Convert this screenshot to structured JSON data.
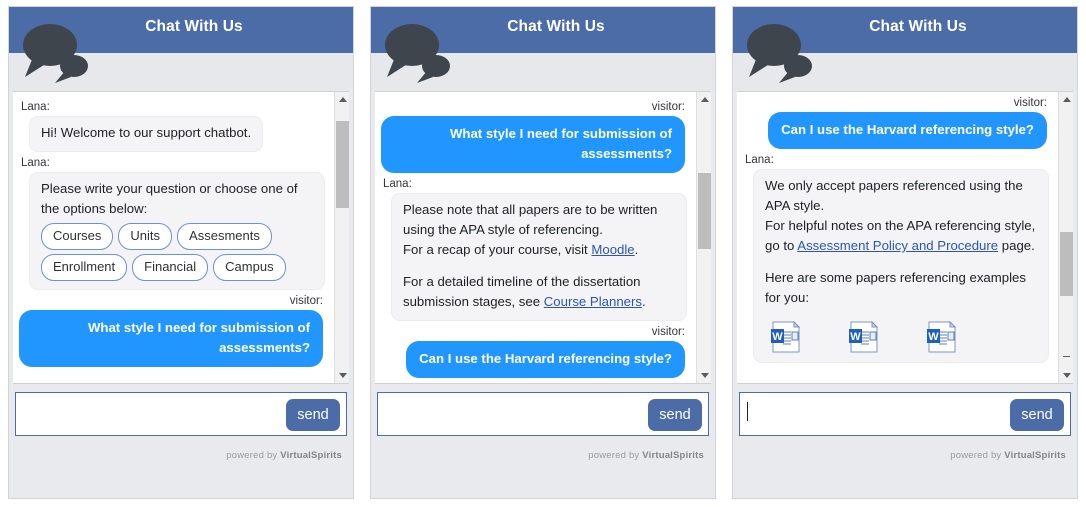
{
  "widget": {
    "title": "Chat With Us",
    "logo_icon": "chat-bubbles-icon",
    "send_label": "send",
    "input_placeholder": "",
    "powered_prefix": "powered by ",
    "powered_brand": "VirtualSpirits",
    "bot_name": "Lana:",
    "visitor_name": "visitor:",
    "scroll_up_icon": "scroll-up-arrow-icon",
    "scroll_down_icon": "scroll-down-arrow-icon",
    "minimize_icon": "minimize-icon",
    "doc_icon": "word-document-icon"
  },
  "colors": {
    "header_blue": "#4c6ca8",
    "visitor_bubble_blue": "#2196ff",
    "bot_bubble_grey": "#f4f4f6",
    "shell_grey": "#e9eaee",
    "link_blue": "#2b55b5",
    "option_border": "#6f8fd6"
  },
  "panels": [
    {
      "id": "panel-1",
      "input_value": "",
      "input_has_caret": false,
      "scroll_thumb_top_pct": 10,
      "scroll_thumb_height_pct": 30,
      "has_minimize": false,
      "messages": [
        {
          "type": "bot",
          "who": "Lana:",
          "lines": [
            "Hi! Welcome to our support chatbot."
          ]
        },
        {
          "type": "bot-options",
          "who": "Lana:",
          "lines": [
            "Please write your question or choose one of the options below:"
          ],
          "options": [
            "Courses",
            "Units",
            "Assesments",
            "Enrollment",
            "Financial",
            "Campus"
          ]
        },
        {
          "type": "visitor",
          "who": "visitor:",
          "lines": [
            "What style I need for submission of assessments?"
          ]
        }
      ]
    },
    {
      "id": "panel-2",
      "input_value": "",
      "input_has_caret": false,
      "scroll_thumb_top_pct": 28,
      "scroll_thumb_height_pct": 26,
      "has_minimize": false,
      "messages": [
        {
          "type": "visitor",
          "who": "visitor:",
          "lines": [
            "What style I need for submission of assessments?"
          ]
        },
        {
          "type": "bot-rich",
          "who": "Lana:",
          "paragraphs": [
            [
              {
                "t": "Please note that all papers are to be written using the APA style of referencing."
              }
            ],
            [
              {
                "t": "For a recap of your course, visit "
              },
              {
                "t": "Moodle",
                "link": true
              },
              {
                "t": "."
              }
            ],
            [
              {
                "t": ""
              }
            ],
            [
              {
                "t": "For a detailed timeline of the dissertation submission stages, see "
              },
              {
                "t": "Course Planners",
                "link": true
              },
              {
                "t": "."
              }
            ]
          ]
        },
        {
          "type": "visitor",
          "who": "visitor:",
          "lines": [
            "Can I use the Harvard referencing style?"
          ]
        }
      ]
    },
    {
      "id": "panel-3",
      "input_value": "",
      "input_has_caret": true,
      "scroll_thumb_top_pct": 48,
      "scroll_thumb_height_pct": 22,
      "has_minimize": true,
      "messages": [
        {
          "type": "visitor",
          "who": "visitor:",
          "lines": [
            "Can I use the Harvard referencing style?"
          ]
        },
        {
          "type": "bot-rich",
          "who": "Lana:",
          "paragraphs": [
            [
              {
                "t": "We only accept papers referenced using the APA style."
              }
            ],
            [
              {
                "t": "For helpful notes on the APA referencing style, go to "
              },
              {
                "t": "Assessment Policy and Procedure",
                "link": true
              },
              {
                "t": " page."
              }
            ],
            [
              {
                "t": ""
              }
            ],
            [
              {
                "t": "Here are some papers referencing examples for you:"
              }
            ]
          ],
          "documents": [
            "word-document-icon",
            "word-document-icon",
            "word-document-icon"
          ]
        }
      ]
    }
  ]
}
